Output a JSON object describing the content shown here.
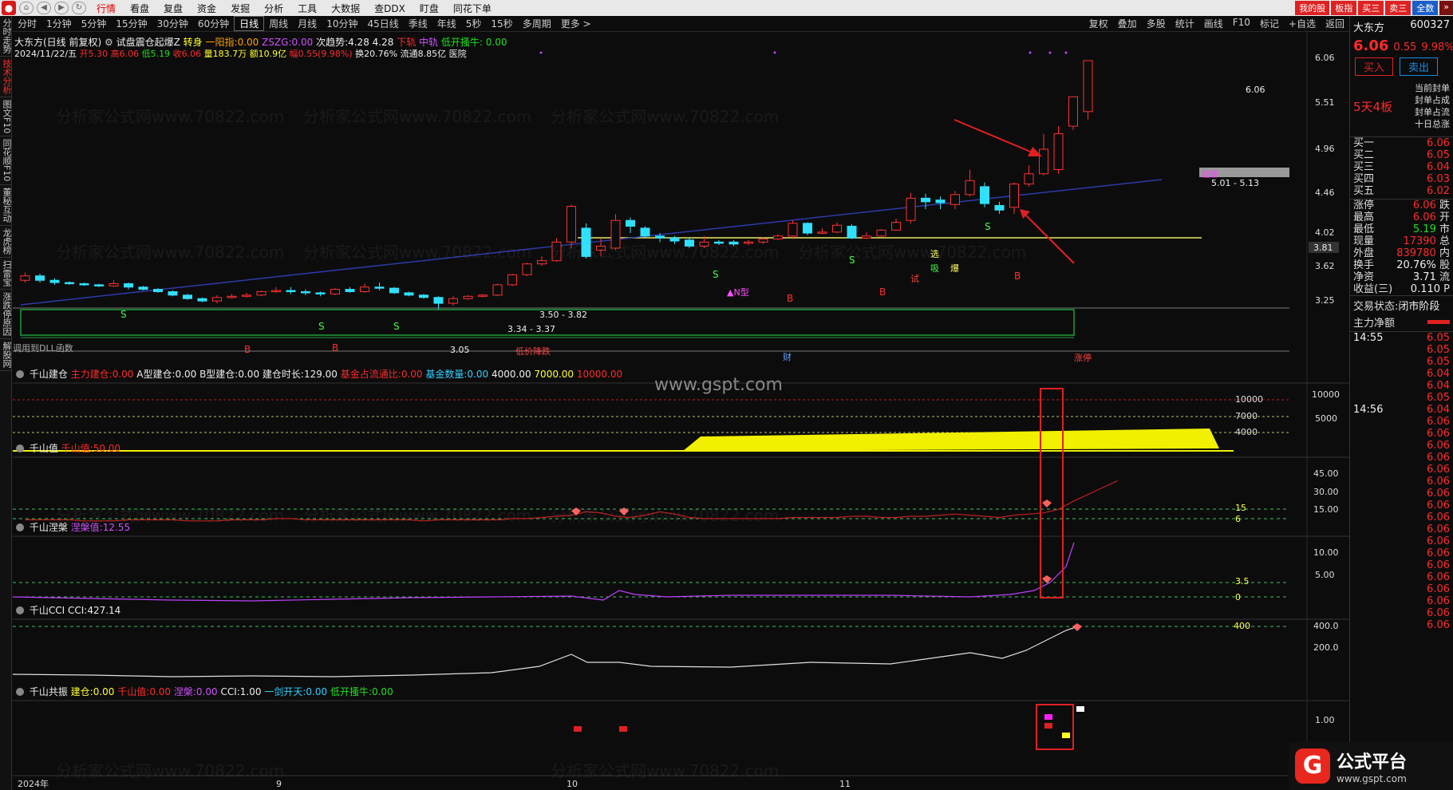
{
  "menubar": {
    "items": [
      "行情",
      "看盘",
      "复盘",
      "资金",
      "发掘",
      "分析",
      "工具",
      "大数据",
      "查DDX",
      "盯盘",
      "同花下单"
    ],
    "right_tabs": [
      "我的股",
      "板指",
      "买三",
      "卖三",
      "全数"
    ]
  },
  "leftbar": [
    "分时走势",
    "技术分析",
    "图文F10",
    "同花顺F10",
    "董秘互动",
    "龙虎榜",
    "扫雷宝",
    "涨跌停原因",
    "解股网"
  ],
  "periods": [
    "分时",
    "1分钟",
    "5分钟",
    "15分钟",
    "30分钟",
    "60分钟",
    "日线",
    "周线",
    "月线",
    "10分钟",
    "45日线",
    "季线",
    "年线",
    "5秒",
    "15秒",
    "多周期",
    "更多 >"
  ],
  "active_period": "日线",
  "tools": [
    "复权",
    "叠加",
    "多股",
    "统计",
    "画线",
    "F10",
    "标记",
    "+自选",
    "返回"
  ],
  "info_line1": {
    "stock": "大东方(日线 前复权)",
    "formula": "试盘震仓起爆Z",
    "turn": "转身",
    "yiyangzhi_label": "一阳指:",
    "yiyangzhi": "0.00",
    "zszg_label": "ZSZG:",
    "zszg": "0.00",
    "trend_label": "次趋势:",
    "trend": "4.28",
    "mid_value": "4.28",
    "down_label": "下轨",
    "mid_label": "中轨",
    "low_open": "低开搔牛: 0.00"
  },
  "info_line2": {
    "date": "2024/11/22/五",
    "open_label": "开",
    "open": "5.30",
    "high_label": "高",
    "high": "6.06",
    "low_label": "低",
    "low": "5.19",
    "close_label": "收",
    "close": "6.06",
    "vol_label": "量",
    "vol": "183.7万",
    "amount_label": "额",
    "amount": "10.9亿",
    "chg_label": "幅",
    "chg": "0.55(9.98%)",
    "turnover_label": "换",
    "turnover": "20.76%",
    "float_label": "流通",
    "float": "8.85亿",
    "sector": "医院"
  },
  "main_axis": [
    "6.06",
    "5.51",
    "4.96",
    "4.46",
    "4.02",
    "3.62",
    "3.25"
  ],
  "price_badge": "3.81",
  "annotations": {
    "range1": "5.01 - 5.13",
    "range2": "3.50 - 3.82",
    "range3": "3.34 - 3.37",
    "low_price": "3.05",
    "high_price": "6.06",
    "dll": "调用到DLL函数",
    "cheap": "低价降跌",
    "cai": "财",
    "zhangting": "涨停",
    "npattern": "▲N型",
    "shi": "试",
    "xi": "吸",
    "bao": "爆",
    "xuan": "选",
    "qi": "起爆"
  },
  "watermark": "分析家公式网www.70822.com",
  "site": "www.gspt.com",
  "ind1": {
    "name": "千山建仓",
    "main_label": "主力建仓:",
    "main": "0.00",
    "a_label": "A型建仓:",
    "a": "0.00",
    "b_label": "B型建仓:",
    "b": "0.00",
    "dur_label": "建仓时长:",
    "dur": "129.00",
    "ratio_label": "基金占流通比:",
    "ratio": "0.00",
    "count_label": "基金数量:",
    "count": "0.00",
    "v1": "4000.00",
    "v2": "7000.00",
    "v3": "10000.00",
    "axis": [
      "10000",
      "5000"
    ],
    "levels": [
      "10000",
      "7000",
      "4000"
    ]
  },
  "ind2": {
    "name": "千山值",
    "val_label": "千山值:",
    "val": "50.00",
    "axis": [
      "45.00",
      "30.00",
      "15.00"
    ],
    "levels": [
      "15",
      "6"
    ]
  },
  "ind3": {
    "name": "千山涅槃",
    "val_label": "涅槃值:",
    "val": "12.55",
    "axis": [
      "10.00",
      "5.00"
    ],
    "levels": [
      "3.5",
      "0"
    ]
  },
  "ind4": {
    "name": "千山CCI",
    "val_label": "CCI:",
    "val": "427.14",
    "axis": [
      "400.0",
      "200.0"
    ],
    "level": "400"
  },
  "ind5": {
    "name": "千山共振",
    "jc_label": "建仓:",
    "jc": "0.00",
    "qs_label": "千山值:",
    "qs": "0.00",
    "np_label": "涅槃:",
    "np": "0.00",
    "cci_label": "CCI:",
    "cci": "1.00",
    "yj_label": "一剑开天:",
    "yj": "0.00",
    "dk_label": "低开搔牛:",
    "dk": "0.00",
    "axis": "1.00"
  },
  "xaxis": [
    "2024年",
    "9",
    "10",
    "11"
  ],
  "right_panel": {
    "name": "大东方",
    "code": "600327",
    "price": "6.06",
    "change": "0.55",
    "pct": "9.98%",
    "buy": "买入",
    "sell": "卖出",
    "board": "5天4板",
    "seal_items": [
      "当前封单",
      "封单占成",
      "封单占流",
      "十日总涨"
    ],
    "bids": [
      {
        "label": "买一",
        "price": "6.06"
      },
      {
        "label": "买二",
        "price": "6.05"
      },
      {
        "label": "买三",
        "price": "6.04"
      },
      {
        "label": "买四",
        "price": "6.03"
      },
      {
        "label": "买五",
        "price": "6.02"
      }
    ],
    "stats": [
      {
        "label": "涨停",
        "value": "6.06",
        "suffix": "跌"
      },
      {
        "label": "最高",
        "value": "6.06",
        "suffix": "开"
      },
      {
        "label": "最低",
        "value": "5.19",
        "suffix": "市"
      },
      {
        "label": "现量",
        "value": "17390",
        "suffix": "总"
      },
      {
        "label": "外盘",
        "value": "839780",
        "suffix": "内"
      },
      {
        "label": "换手",
        "value": "20.76%",
        "suffix": "股"
      },
      {
        "label": "净资",
        "value": "3.71",
        "suffix": "流"
      },
      {
        "label": "收益(三)",
        "value": "0.110",
        "suffix": "P"
      }
    ],
    "status_label": "交易状态:",
    "status": "闭市阶段",
    "net_label": "主力净额",
    "ticks": [
      {
        "time": "14:55",
        "price": "6.05"
      },
      {
        "time": "",
        "price": "6.05"
      },
      {
        "time": "",
        "price": "6.05"
      },
      {
        "time": "",
        "price": "6.04"
      },
      {
        "time": "",
        "price": "6.04"
      },
      {
        "time": "",
        "price": "6.05"
      },
      {
        "time": "14:56",
        "price": "6.04"
      },
      {
        "time": "",
        "price": "6.06"
      },
      {
        "time": "",
        "price": "6.06"
      },
      {
        "time": "",
        "price": "6.06"
      },
      {
        "time": "",
        "price": "6.06"
      },
      {
        "time": "",
        "price": "6.06"
      },
      {
        "time": "",
        "price": "6.06"
      },
      {
        "time": "",
        "price": "6.06"
      },
      {
        "time": "",
        "price": "6.06"
      },
      {
        "time": "",
        "price": "6.06"
      },
      {
        "time": "",
        "price": "6.06"
      },
      {
        "time": "",
        "price": "6.06"
      },
      {
        "time": "",
        "price": "6.06"
      },
      {
        "time": "",
        "price": "6.06"
      },
      {
        "time": "",
        "price": "6.06"
      },
      {
        "time": "",
        "price": "6.06"
      },
      {
        "time": "",
        "price": "6.06"
      },
      {
        "time": "",
        "price": "6.06"
      },
      {
        "time": "",
        "price": "6.06"
      }
    ]
  },
  "logo": {
    "title": "公式平台",
    "url": "www.gspt.com"
  },
  "candles": [
    {
      "o": 3.4,
      "c": 3.44,
      "h": 3.47,
      "l": 3.38
    },
    {
      "o": 3.44,
      "c": 3.4,
      "h": 3.46,
      "l": 3.38
    },
    {
      "o": 3.4,
      "c": 3.38,
      "h": 3.42,
      "l": 3.36
    },
    {
      "o": 3.38,
      "c": 3.37,
      "h": 3.39,
      "l": 3.36
    },
    {
      "o": 3.37,
      "c": 3.36,
      "h": 3.38,
      "l": 3.35
    },
    {
      "o": 3.36,
      "c": 3.35,
      "h": 3.37,
      "l": 3.34
    },
    {
      "o": 3.35,
      "c": 3.37,
      "h": 3.4,
      "l": 3.34
    },
    {
      "o": 3.37,
      "c": 3.34,
      "h": 3.38,
      "l": 3.32
    },
    {
      "o": 3.34,
      "c": 3.32,
      "h": 3.35,
      "l": 3.31
    },
    {
      "o": 3.32,
      "c": 3.3,
      "h": 3.33,
      "l": 3.29
    },
    {
      "o": 3.3,
      "c": 3.27,
      "h": 3.31,
      "l": 3.26
    },
    {
      "o": 3.27,
      "c": 3.24,
      "h": 3.28,
      "l": 3.23
    },
    {
      "o": 3.24,
      "c": 3.22,
      "h": 3.25,
      "l": 3.21
    },
    {
      "o": 3.22,
      "c": 3.25,
      "h": 3.27,
      "l": 3.2
    },
    {
      "o": 3.25,
      "c": 3.26,
      "h": 3.28,
      "l": 3.24
    },
    {
      "o": 3.26,
      "c": 3.27,
      "h": 3.29,
      "l": 3.25
    },
    {
      "o": 3.27,
      "c": 3.3,
      "h": 3.31,
      "l": 3.26
    },
    {
      "o": 3.3,
      "c": 3.31,
      "h": 3.34,
      "l": 3.29
    },
    {
      "o": 3.31,
      "c": 3.3,
      "h": 3.34,
      "l": 3.28
    },
    {
      "o": 3.3,
      "c": 3.29,
      "h": 3.32,
      "l": 3.27
    },
    {
      "o": 3.29,
      "c": 3.28,
      "h": 3.3,
      "l": 3.26
    },
    {
      "o": 3.28,
      "c": 3.32,
      "h": 3.33,
      "l": 3.27
    },
    {
      "o": 3.32,
      "c": 3.3,
      "h": 3.34,
      "l": 3.29
    },
    {
      "o": 3.3,
      "c": 3.34,
      "h": 3.37,
      "l": 3.29
    },
    {
      "o": 3.34,
      "c": 3.33,
      "h": 3.38,
      "l": 3.31
    },
    {
      "o": 3.33,
      "c": 3.29,
      "h": 3.34,
      "l": 3.28
    },
    {
      "o": 3.29,
      "c": 3.27,
      "h": 3.3,
      "l": 3.26
    },
    {
      "o": 3.27,
      "c": 3.25,
      "h": 3.28,
      "l": 3.24
    },
    {
      "o": 3.25,
      "c": 3.2,
      "h": 3.26,
      "l": 3.15
    },
    {
      "o": 3.2,
      "c": 3.24,
      "h": 3.26,
      "l": 3.18
    },
    {
      "o": 3.24,
      "c": 3.26,
      "h": 3.27,
      "l": 3.23
    },
    {
      "o": 3.26,
      "c": 3.27,
      "h": 3.28,
      "l": 3.25
    },
    {
      "o": 3.27,
      "c": 3.36,
      "h": 3.37,
      "l": 3.26
    },
    {
      "o": 3.36,
      "c": 3.45,
      "h": 3.46,
      "l": 3.35
    },
    {
      "o": 3.45,
      "c": 3.55,
      "h": 3.56,
      "l": 3.44
    },
    {
      "o": 3.55,
      "c": 3.58,
      "h": 3.62,
      "l": 3.53
    },
    {
      "o": 3.58,
      "c": 3.76,
      "h": 3.8,
      "l": 3.57
    },
    {
      "o": 3.76,
      "c": 4.13,
      "h": 4.15,
      "l": 3.7
    },
    {
      "o": 3.9,
      "c": 3.62,
      "h": 3.95,
      "l": 3.6
    },
    {
      "o": 3.68,
      "c": 3.72,
      "h": 3.8,
      "l": 3.62
    },
    {
      "o": 3.7,
      "c": 3.98,
      "h": 4.05,
      "l": 3.68
    },
    {
      "o": 3.98,
      "c": 3.92,
      "h": 4.01,
      "l": 3.85
    },
    {
      "o": 3.9,
      "c": 3.82,
      "h": 3.92,
      "l": 3.8
    },
    {
      "o": 3.82,
      "c": 3.8,
      "h": 3.85,
      "l": 3.76
    },
    {
      "o": 3.8,
      "c": 3.77,
      "h": 3.82,
      "l": 3.74
    },
    {
      "o": 3.78,
      "c": 3.72,
      "h": 3.8,
      "l": 3.7
    },
    {
      "o": 3.72,
      "c": 3.76,
      "h": 3.82,
      "l": 3.7
    },
    {
      "o": 3.76,
      "c": 3.75,
      "h": 3.78,
      "l": 3.73
    },
    {
      "o": 3.76,
      "c": 3.74,
      "h": 3.78,
      "l": 3.72
    },
    {
      "o": 3.75,
      "c": 3.76,
      "h": 3.78,
      "l": 3.73
    },
    {
      "o": 3.76,
      "c": 3.79,
      "h": 3.81,
      "l": 3.74
    },
    {
      "o": 3.79,
      "c": 3.82,
      "h": 3.84,
      "l": 3.78
    },
    {
      "o": 3.82,
      "c": 3.95,
      "h": 3.98,
      "l": 3.8
    },
    {
      "o": 3.95,
      "c": 3.85,
      "h": 3.96,
      "l": 3.83
    },
    {
      "o": 3.85,
      "c": 3.86,
      "h": 3.9,
      "l": 3.84
    },
    {
      "o": 3.86,
      "c": 3.93,
      "h": 3.96,
      "l": 3.85
    },
    {
      "o": 3.92,
      "c": 3.8,
      "h": 3.94,
      "l": 3.79
    },
    {
      "o": 3.8,
      "c": 3.82,
      "h": 3.86,
      "l": 3.79
    },
    {
      "o": 3.82,
      "c": 3.88,
      "h": 3.89,
      "l": 3.81
    },
    {
      "o": 3.88,
      "c": 3.96,
      "h": 4.0,
      "l": 3.87
    },
    {
      "o": 3.98,
      "c": 4.22,
      "h": 4.28,
      "l": 3.95
    },
    {
      "o": 4.22,
      "c": 4.18,
      "h": 4.27,
      "l": 4.1
    },
    {
      "o": 4.2,
      "c": 4.17,
      "h": 4.24,
      "l": 4.1
    },
    {
      "o": 4.15,
      "c": 4.26,
      "h": 4.3,
      "l": 4.1
    },
    {
      "o": 4.26,
      "c": 4.42,
      "h": 4.55,
      "l": 4.24
    },
    {
      "o": 4.35,
      "c": 4.16,
      "h": 4.4,
      "l": 4.12
    },
    {
      "o": 4.14,
      "c": 4.09,
      "h": 4.18,
      "l": 4.05
    },
    {
      "o": 4.12,
      "c": 4.38,
      "h": 4.4,
      "l": 4.05
    },
    {
      "o": 4.38,
      "c": 4.5,
      "h": 4.6,
      "l": 4.35
    },
    {
      "o": 4.5,
      "c": 4.8,
      "h": 5.0,
      "l": 4.48
    },
    {
      "o": 4.55,
      "c": 5.0,
      "h": 5.1,
      "l": 4.5
    },
    {
      "o": 5.1,
      "c": 5.51,
      "h": 5.51,
      "l": 5.05
    },
    {
      "o": 5.3,
      "c": 6.06,
      "h": 6.06,
      "l": 5.19
    }
  ],
  "ind2_series": [
    6,
    6,
    6,
    6,
    5,
    5,
    5,
    6,
    6,
    6,
    6,
    5,
    5,
    5,
    6,
    6,
    6,
    7,
    7,
    6,
    6,
    6,
    6,
    6,
    6,
    6,
    6,
    5,
    6,
    6,
    6,
    6,
    6,
    7,
    7,
    8,
    9,
    10,
    13,
    12,
    9,
    8,
    10,
    13,
    11,
    8,
    7,
    7,
    7,
    7,
    7,
    7,
    8,
    8,
    8,
    8,
    9,
    9,
    8,
    8,
    9,
    9,
    10,
    11,
    10,
    9,
    8,
    10,
    11,
    12,
    15,
    22,
    28,
    34,
    40
  ]
}
